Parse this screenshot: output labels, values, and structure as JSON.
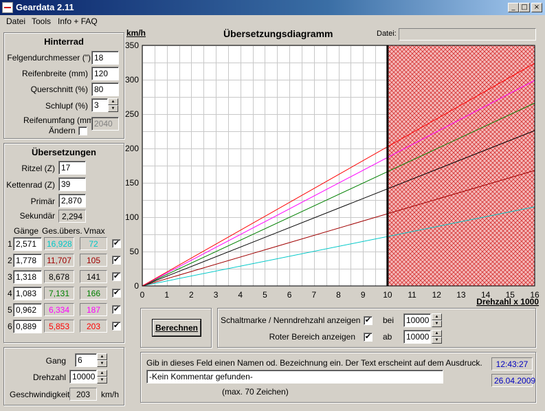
{
  "window": {
    "title": "Geardata 2.11",
    "min": "_",
    "max": "□",
    "close": "×"
  },
  "menu": [
    "Datei",
    "Tools",
    "Info + FAQ"
  ],
  "hinterrad": {
    "title": "Hinterrad",
    "felgen_label": "Felgendurchmesser (\")",
    "felgen_value": "18",
    "reifenbreite_label": "Reifenbreite (mm)",
    "reifenbreite_value": "120",
    "querschnitt_label": "Querschnitt (%)",
    "querschnitt_value": "80",
    "schlupf_label": "Schlupf (%)",
    "schlupf_value": "3",
    "umfang_label": "Reifenumfang (mm)",
    "aendern_label": "Ändern",
    "aendern_checked": false,
    "umfang_value": "2040"
  },
  "uebersetzungen": {
    "title": "Übersetzungen",
    "ritzel_label": "Ritzel (Z)",
    "ritzel_value": "17",
    "kettenrad_label": "Kettenrad (Z)",
    "kettenrad_value": "39",
    "primaer_label": "Primär",
    "primaer_value": "2,870",
    "sekundaer_label": "Sekundär",
    "sekundaer_value": "2,294",
    "col_gaenge": "Gänge",
    "col_gesuebers": "Ges.übers.",
    "col_vmax": "Vmax",
    "gears": [
      {
        "num": "1",
        "ratio": "2,571",
        "total": "16,928",
        "vmax": "72",
        "color": "#00c8c8",
        "checked": "✔"
      },
      {
        "num": "2",
        "ratio": "1,778",
        "total": "11,707",
        "vmax": "105",
        "color": "#a00000",
        "checked": "✔"
      },
      {
        "num": "3",
        "ratio": "1,318",
        "total": "8,678",
        "vmax": "141",
        "color": "#000000",
        "checked": "✔"
      },
      {
        "num": "4",
        "ratio": "1,083",
        "total": "7,131",
        "vmax": "166",
        "color": "#008000",
        "checked": "✔"
      },
      {
        "num": "5",
        "ratio": "0,962",
        "total": "6,334",
        "vmax": "187",
        "color": "#ff00ff",
        "checked": "✔"
      },
      {
        "num": "6",
        "ratio": "0,889",
        "total": "5,853",
        "vmax": "203",
        "color": "#ff0000",
        "checked": "✔"
      }
    ]
  },
  "bottom_left": {
    "gang_label": "Gang",
    "gang_value": "6",
    "drehzahl_label": "Drehzahl",
    "drehzahl_value": "10000",
    "geschw_label": "Geschwindigkeit:",
    "geschw_value": "203",
    "geschw_unit": "km/h"
  },
  "chart_header": {
    "unit": "km/h",
    "title": "Übersetzungsdiagramm",
    "datei_label": "Datei:",
    "datei_value": ""
  },
  "chart_data": {
    "type": "line",
    "title": "Übersetzungsdiagramm",
    "ylabel": "km/h",
    "xlabel": "Drehzahl x 1000",
    "xlim": [
      0,
      16
    ],
    "ylim": [
      0,
      350
    ],
    "xticks": [
      0,
      1,
      2,
      3,
      4,
      5,
      6,
      7,
      8,
      9,
      10,
      11,
      12,
      13,
      14,
      15,
      16
    ],
    "yticks": [
      0,
      50,
      100,
      150,
      200,
      250,
      300,
      350
    ],
    "grid": true,
    "red_zone_start": 10,
    "shift_marker": 10,
    "series": [
      {
        "color": "#00c8c8",
        "x": [
          0,
          16
        ],
        "y": [
          0,
          115
        ]
      },
      {
        "color": "#a00000",
        "x": [
          0,
          16
        ],
        "y": [
          0,
          168
        ]
      },
      {
        "color": "#000000",
        "x": [
          0,
          16
        ],
        "y": [
          0,
          226
        ]
      },
      {
        "color": "#008000",
        "x": [
          0,
          16
        ],
        "y": [
          0,
          266
        ]
      },
      {
        "color": "#ff00ff",
        "x": [
          0,
          16
        ],
        "y": [
          0,
          299
        ]
      },
      {
        "color": "#ff0000",
        "x": [
          0,
          16
        ],
        "y": [
          0,
          324
        ]
      }
    ]
  },
  "berechnen_label": "Berechnen",
  "options": {
    "schalt_label": "Schaltmarke / Nenndrehzahl anzeigen",
    "schalt_checked": "✔",
    "bei_label": "bei",
    "bei_value": "10000",
    "roter_label": "Roter Bereich anzeigen",
    "roter_checked": "✔",
    "ab_label": "ab",
    "ab_value": "10000"
  },
  "comment": {
    "hint": "Gib in dieses Feld einen Namen od. Bezeichnung ein. Der Text erscheint auf dem Ausdruck.",
    "value": "-Kein Kommentar gefunden-",
    "max": "(max. 70 Zeichen)",
    "time": "12:43:27",
    "date": "26.04.2009"
  }
}
